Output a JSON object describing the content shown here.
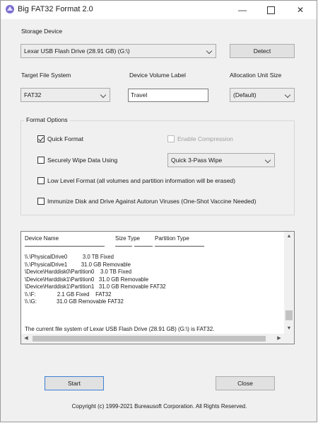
{
  "window": {
    "title": "Big FAT32 Format 2.0",
    "minimize": "—",
    "close": "✕"
  },
  "storage": {
    "label": "Storage Device",
    "selected": "Lexar USB Flash Drive (28.91 GB) (G:\\)",
    "detect_label": "Detect"
  },
  "fields": {
    "target_fs_label": "Target File System",
    "target_fs_value": "FAT32",
    "volume_label_label": "Device Volume Label",
    "volume_label_value": "Travel",
    "alloc_label": "Allocation Unit Size",
    "alloc_value": "(Default)"
  },
  "options": {
    "group_title": "Format Options",
    "quick_format": {
      "label": "Quick Format",
      "checked": true
    },
    "enable_compression": {
      "label": "Enable Compression",
      "checked": false,
      "disabled": true
    },
    "secure_wipe": {
      "label": "Securely Wipe Data Using",
      "checked": false
    },
    "wipe_method": "Quick 3-Pass Wipe",
    "low_level": {
      "label": "Low Level Format (all volumes and partition information will be erased)",
      "checked": false
    },
    "immunize": {
      "label": "Immunize Disk and Drive Against Autorun Viruses (One-Shot Vaccine Needed)",
      "checked": false
    }
  },
  "device_list": {
    "headers": {
      "name": "Device Name",
      "size_type": "Size Type",
      "partition_type": "Partition Type"
    },
    "rows": [
      "\\\\.\\PhysicalDrive0          3.0 TB Fixed",
      "\\\\.\\PhysicalDrive1         31.0 GB Removable",
      "\\Device\\Harddisk0\\Partition0    3.0 TB Fixed",
      "\\Device\\Harddisk1\\Partition0   31.0 GB Removable",
      "\\Device\\Harddisk1\\Partition1   31.0 GB Removable FAT32",
      "\\\\.\\F:              2.1 GB Fixed    FAT32",
      "\\\\.\\G:             31.0 GB Removable FAT32"
    ],
    "status": "The current file system of Lexar USB Flash Drive (28.91 GB) (G:\\) is FAT32."
  },
  "buttons": {
    "start": "Start",
    "close": "Close"
  },
  "footer": {
    "copyright": "Copyright (c) 1999-2021 Bureausoft Corporation. All Rights Reserved."
  }
}
